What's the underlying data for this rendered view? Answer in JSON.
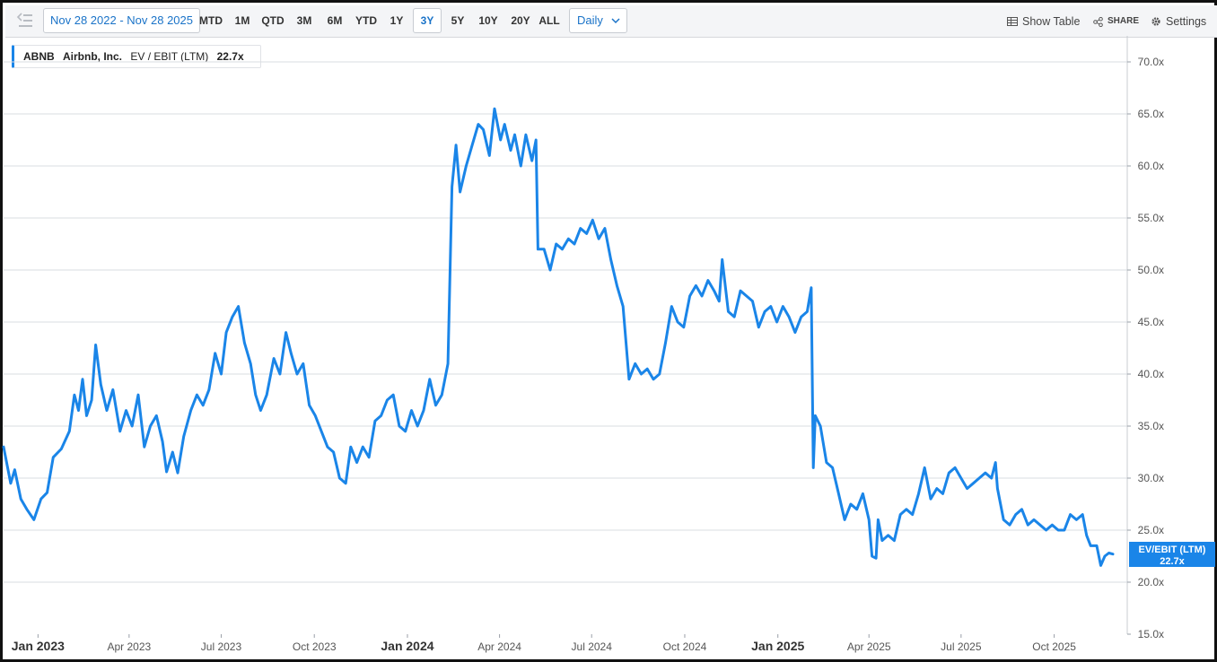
{
  "toolbar": {
    "date_range": "Nov 28 2022 - Nov 28 2025",
    "ranges": [
      "MTD",
      "1M",
      "QTD",
      "3M",
      "6M",
      "YTD",
      "1Y",
      "3Y",
      "5Y",
      "10Y",
      "20Y",
      "ALL"
    ],
    "active_range": "3Y",
    "interval": "Daily",
    "show_table": "Show Table",
    "share": "SHARE",
    "settings": "Settings"
  },
  "legend": {
    "ticker": "ABNB",
    "company": "Airbnb, Inc.",
    "metric": "EV / EBIT (LTM)",
    "value": "22.7x"
  },
  "price_tag": {
    "label": "EV/EBIT (LTM)",
    "value": "22.7x"
  },
  "colors": {
    "series": "#1a85e8",
    "accent": "#1a73c8",
    "grid": "#d9dce1"
  },
  "chart_data": {
    "type": "line",
    "title": "",
    "xlabel": "",
    "ylabel": "",
    "ylim": [
      15,
      72.5
    ],
    "y_ticks": [
      "15.0x",
      "20.0x",
      "25.0x",
      "30.0x",
      "35.0x",
      "40.0x",
      "45.0x",
      "50.0x",
      "55.0x",
      "60.0x",
      "65.0x",
      "70.0x"
    ],
    "y_tick_values": [
      15,
      20,
      25,
      30,
      35,
      40,
      45,
      50,
      55,
      60,
      65,
      70
    ],
    "x_range": [
      "2022-11-28",
      "2025-11-28"
    ],
    "x_ticks": [
      {
        "label": "Jan 2023",
        "date": "2023-01-01",
        "bold": true
      },
      {
        "label": "Apr 2023",
        "date": "2023-04-01",
        "bold": false
      },
      {
        "label": "Jul 2023",
        "date": "2023-07-01",
        "bold": false
      },
      {
        "label": "Oct 2023",
        "date": "2023-10-01",
        "bold": false
      },
      {
        "label": "Jan 2024",
        "date": "2024-01-01",
        "bold": true
      },
      {
        "label": "Apr 2024",
        "date": "2024-04-01",
        "bold": false
      },
      {
        "label": "Jul 2024",
        "date": "2024-07-01",
        "bold": false
      },
      {
        "label": "Oct 2024",
        "date": "2024-10-01",
        "bold": false
      },
      {
        "label": "Jan 2025",
        "date": "2025-01-01",
        "bold": true
      },
      {
        "label": "Apr 2025",
        "date": "2025-04-01",
        "bold": false
      },
      {
        "label": "Jul 2025",
        "date": "2025-07-01",
        "bold": false
      },
      {
        "label": "Oct 2025",
        "date": "2025-10-01",
        "bold": false
      }
    ],
    "series": [
      {
        "name": "EV/EBIT (LTM)",
        "points": [
          [
            "2022-11-28",
            33.0
          ],
          [
            "2022-12-05",
            29.5
          ],
          [
            "2022-12-09",
            30.8
          ],
          [
            "2022-12-15",
            28.0
          ],
          [
            "2022-12-21",
            27.0
          ],
          [
            "2022-12-28",
            26.0
          ],
          [
            "2023-01-04",
            28.0
          ],
          [
            "2023-01-10",
            28.6
          ],
          [
            "2023-01-16",
            32.0
          ],
          [
            "2023-01-24",
            32.8
          ],
          [
            "2023-02-01",
            34.5
          ],
          [
            "2023-02-06",
            38.0
          ],
          [
            "2023-02-10",
            36.5
          ],
          [
            "2023-02-14",
            39.5
          ],
          [
            "2023-02-18",
            36.0
          ],
          [
            "2023-02-23",
            37.5
          ],
          [
            "2023-02-27",
            42.8
          ],
          [
            "2023-03-04",
            39.0
          ],
          [
            "2023-03-10",
            36.5
          ],
          [
            "2023-03-16",
            38.5
          ],
          [
            "2023-03-23",
            34.5
          ],
          [
            "2023-03-29",
            36.5
          ],
          [
            "2023-04-04",
            35.0
          ],
          [
            "2023-04-10",
            38.0
          ],
          [
            "2023-04-16",
            33.0
          ],
          [
            "2023-04-22",
            35.0
          ],
          [
            "2023-04-28",
            36.0
          ],
          [
            "2023-05-04",
            33.5
          ],
          [
            "2023-05-08",
            30.6
          ],
          [
            "2023-05-14",
            32.5
          ],
          [
            "2023-05-19",
            30.5
          ],
          [
            "2023-05-25",
            34.0
          ],
          [
            "2023-06-01",
            36.5
          ],
          [
            "2023-06-07",
            38.0
          ],
          [
            "2023-06-13",
            37.0
          ],
          [
            "2023-06-19",
            38.5
          ],
          [
            "2023-06-25",
            42.0
          ],
          [
            "2023-07-01",
            40.0
          ],
          [
            "2023-07-06",
            44.0
          ],
          [
            "2023-07-12",
            45.5
          ],
          [
            "2023-07-18",
            46.5
          ],
          [
            "2023-07-24",
            43.0
          ],
          [
            "2023-07-30",
            41.0
          ],
          [
            "2023-08-04",
            38.0
          ],
          [
            "2023-08-09",
            36.5
          ],
          [
            "2023-08-15",
            38.0
          ],
          [
            "2023-08-22",
            41.5
          ],
          [
            "2023-08-28",
            40.0
          ],
          [
            "2023-09-03",
            44.0
          ],
          [
            "2023-09-08",
            42.0
          ],
          [
            "2023-09-14",
            40.0
          ],
          [
            "2023-09-20",
            41.0
          ],
          [
            "2023-09-26",
            37.0
          ],
          [
            "2023-10-02",
            36.0
          ],
          [
            "2023-10-08",
            34.5
          ],
          [
            "2023-10-14",
            33.0
          ],
          [
            "2023-10-20",
            32.5
          ],
          [
            "2023-10-26",
            30.0
          ],
          [
            "2023-11-01",
            29.5
          ],
          [
            "2023-11-06",
            33.0
          ],
          [
            "2023-11-12",
            31.5
          ],
          [
            "2023-11-18",
            33.0
          ],
          [
            "2023-11-24",
            32.0
          ],
          [
            "2023-11-30",
            35.5
          ],
          [
            "2023-12-06",
            36.0
          ],
          [
            "2023-12-12",
            37.5
          ],
          [
            "2023-12-18",
            38.0
          ],
          [
            "2023-12-24",
            35.0
          ],
          [
            "2023-12-30",
            34.5
          ],
          [
            "2024-01-05",
            36.5
          ],
          [
            "2024-01-11",
            35.0
          ],
          [
            "2024-01-17",
            36.5
          ],
          [
            "2024-01-23",
            39.5
          ],
          [
            "2024-01-29",
            37.0
          ],
          [
            "2024-02-04",
            38.0
          ],
          [
            "2024-02-10",
            41.0
          ],
          [
            "2024-02-14",
            58.0
          ],
          [
            "2024-02-18",
            62.0
          ],
          [
            "2024-02-22",
            57.5
          ],
          [
            "2024-02-28",
            60.0
          ],
          [
            "2024-03-05",
            62.0
          ],
          [
            "2024-03-11",
            64.0
          ],
          [
            "2024-03-16",
            63.5
          ],
          [
            "2024-03-22",
            61.0
          ],
          [
            "2024-03-27",
            65.5
          ],
          [
            "2024-04-02",
            62.5
          ],
          [
            "2024-04-06",
            64.0
          ],
          [
            "2024-04-12",
            61.5
          ],
          [
            "2024-04-16",
            63.0
          ],
          [
            "2024-04-22",
            60.0
          ],
          [
            "2024-04-27",
            63.0
          ],
          [
            "2024-05-03",
            60.5
          ],
          [
            "2024-05-07",
            62.5
          ],
          [
            "2024-05-09",
            52.0
          ],
          [
            "2024-05-15",
            52.0
          ],
          [
            "2024-05-21",
            50.0
          ],
          [
            "2024-05-27",
            52.5
          ],
          [
            "2024-06-02",
            52.0
          ],
          [
            "2024-06-08",
            53.0
          ],
          [
            "2024-06-14",
            52.5
          ],
          [
            "2024-06-20",
            54.0
          ],
          [
            "2024-06-26",
            53.5
          ],
          [
            "2024-07-02",
            54.8
          ],
          [
            "2024-07-08",
            53.0
          ],
          [
            "2024-07-14",
            54.0
          ],
          [
            "2024-07-20",
            51.0
          ],
          [
            "2024-07-26",
            48.5
          ],
          [
            "2024-08-01",
            46.5
          ],
          [
            "2024-08-07",
            39.5
          ],
          [
            "2024-08-13",
            41.0
          ],
          [
            "2024-08-19",
            40.0
          ],
          [
            "2024-08-25",
            40.5
          ],
          [
            "2024-08-31",
            39.5
          ],
          [
            "2024-09-06",
            40.0
          ],
          [
            "2024-09-12",
            43.0
          ],
          [
            "2024-09-18",
            46.5
          ],
          [
            "2024-09-24",
            45.0
          ],
          [
            "2024-09-30",
            44.5
          ],
          [
            "2024-10-06",
            47.5
          ],
          [
            "2024-10-12",
            48.5
          ],
          [
            "2024-10-18",
            47.5
          ],
          [
            "2024-10-24",
            49.0
          ],
          [
            "2024-10-30",
            48.0
          ],
          [
            "2024-11-04",
            47.0
          ],
          [
            "2024-11-07",
            51.0
          ],
          [
            "2024-11-13",
            46.0
          ],
          [
            "2024-11-19",
            45.5
          ],
          [
            "2024-11-25",
            48.0
          ],
          [
            "2024-12-01",
            47.5
          ],
          [
            "2024-12-07",
            47.0
          ],
          [
            "2024-12-13",
            44.5
          ],
          [
            "2024-12-19",
            46.0
          ],
          [
            "2024-12-25",
            46.5
          ],
          [
            "2024-12-31",
            45.0
          ],
          [
            "2025-01-06",
            46.5
          ],
          [
            "2025-01-12",
            45.5
          ],
          [
            "2025-01-18",
            44.0
          ],
          [
            "2025-01-24",
            45.5
          ],
          [
            "2025-01-30",
            46.0
          ],
          [
            "2025-02-03",
            48.3
          ],
          [
            "2025-02-05",
            31.0
          ],
          [
            "2025-02-07",
            36.0
          ],
          [
            "2025-02-12",
            35.0
          ],
          [
            "2025-02-18",
            31.5
          ],
          [
            "2025-02-24",
            31.0
          ],
          [
            "2025-03-02",
            28.5
          ],
          [
            "2025-03-08",
            26.0
          ],
          [
            "2025-03-14",
            27.5
          ],
          [
            "2025-03-20",
            27.0
          ],
          [
            "2025-03-26",
            28.5
          ],
          [
            "2025-04-01",
            26.0
          ],
          [
            "2025-04-04",
            22.5
          ],
          [
            "2025-04-08",
            22.3
          ],
          [
            "2025-04-10",
            26.0
          ],
          [
            "2025-04-14",
            24.0
          ],
          [
            "2025-04-20",
            24.5
          ],
          [
            "2025-04-26",
            24.0
          ],
          [
            "2025-05-02",
            26.5
          ],
          [
            "2025-05-08",
            27.0
          ],
          [
            "2025-05-14",
            26.5
          ],
          [
            "2025-05-20",
            28.5
          ],
          [
            "2025-05-26",
            31.0
          ],
          [
            "2025-06-01",
            28.0
          ],
          [
            "2025-06-07",
            29.0
          ],
          [
            "2025-06-13",
            28.5
          ],
          [
            "2025-06-19",
            30.5
          ],
          [
            "2025-06-25",
            31.0
          ],
          [
            "2025-07-01",
            30.0
          ],
          [
            "2025-07-07",
            29.0
          ],
          [
            "2025-07-13",
            29.5
          ],
          [
            "2025-07-19",
            30.0
          ],
          [
            "2025-07-25",
            30.5
          ],
          [
            "2025-07-31",
            30.0
          ],
          [
            "2025-08-04",
            31.5
          ],
          [
            "2025-08-06",
            29.0
          ],
          [
            "2025-08-12",
            26.0
          ],
          [
            "2025-08-18",
            25.5
          ],
          [
            "2025-08-24",
            26.5
          ],
          [
            "2025-08-30",
            27.0
          ],
          [
            "2025-09-05",
            25.5
          ],
          [
            "2025-09-11",
            26.0
          ],
          [
            "2025-09-17",
            25.5
          ],
          [
            "2025-09-23",
            25.0
          ],
          [
            "2025-09-29",
            25.5
          ],
          [
            "2025-10-05",
            25.0
          ],
          [
            "2025-10-11",
            25.0
          ],
          [
            "2025-10-17",
            26.5
          ],
          [
            "2025-10-23",
            26.0
          ],
          [
            "2025-10-29",
            26.5
          ],
          [
            "2025-11-02",
            24.5
          ],
          [
            "2025-11-06",
            23.5
          ],
          [
            "2025-11-12",
            23.5
          ],
          [
            "2025-11-16",
            21.6
          ],
          [
            "2025-11-20",
            22.5
          ],
          [
            "2025-11-24",
            22.8
          ],
          [
            "2025-11-28",
            22.7
          ]
        ]
      }
    ]
  }
}
